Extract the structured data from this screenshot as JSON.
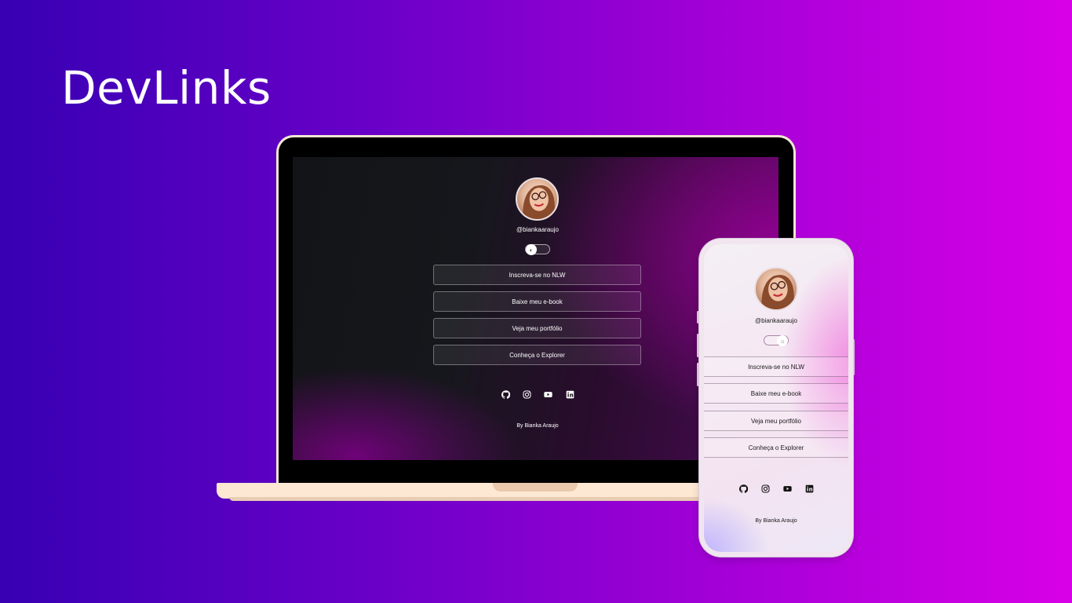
{
  "title": "DevLinks",
  "profile": {
    "handle": "@biankaaraujo"
  },
  "links": [
    {
      "label": "Inscreva-se no NLW"
    },
    {
      "label": "Baixe meu e-book"
    },
    {
      "label": "Veja meu portfólio"
    },
    {
      "label": "Conheça o Explorer"
    }
  ],
  "social": [
    {
      "icon": "github-icon"
    },
    {
      "icon": "instagram-icon"
    },
    {
      "icon": "youtube-icon"
    },
    {
      "icon": "linkedin-icon"
    }
  ],
  "footer": "By Bianka Araujo",
  "colors": {
    "background_start": "#3700b3",
    "background_end": "#d800e6",
    "laptop_frame": "#fde8d3",
    "dark_text": "#ffffff",
    "light_text": "#1a1a1a"
  }
}
